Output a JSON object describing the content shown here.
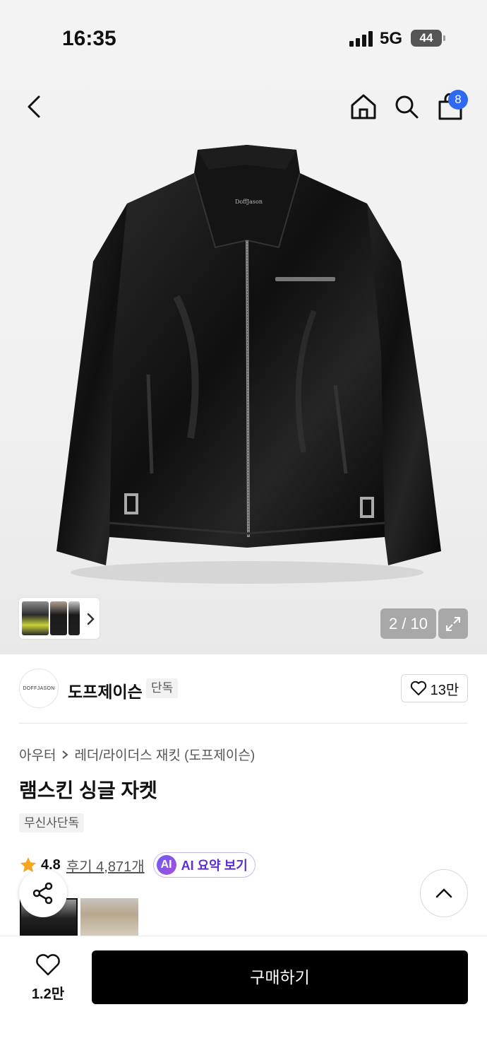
{
  "status": {
    "time": "16:35",
    "network": "5G",
    "battery": "44"
  },
  "header": {
    "cart_count": "8"
  },
  "gallery": {
    "counter": "2 / 10"
  },
  "brand": {
    "logo_text": "DOFFJASON",
    "name": "도프제이슨",
    "tag": "단독",
    "likes": "13만"
  },
  "breadcrumb": {
    "category": "아우터",
    "subcategory": "레더/라이더스 재킷 (도프제이슨)"
  },
  "product": {
    "title": "램스킨 싱글 자켓",
    "tag": "무신사단독"
  },
  "rating": {
    "score": "4.8",
    "reviews": "후기 4,871개",
    "ai_label": "AI 요약 보기",
    "ai_badge": "AI"
  },
  "bottom": {
    "wish_count": "1.2만",
    "buy_label": "구매하기"
  },
  "colors": {
    "accent": "#2f6af2",
    "star": "#f5a623",
    "ai": "#5b2fd1"
  },
  "icons": [
    "back-icon",
    "home-icon",
    "search-icon",
    "cart-icon",
    "chevron-right-icon",
    "expand-icon",
    "heart-icon",
    "star-icon",
    "share-icon",
    "chevron-up-icon"
  ]
}
